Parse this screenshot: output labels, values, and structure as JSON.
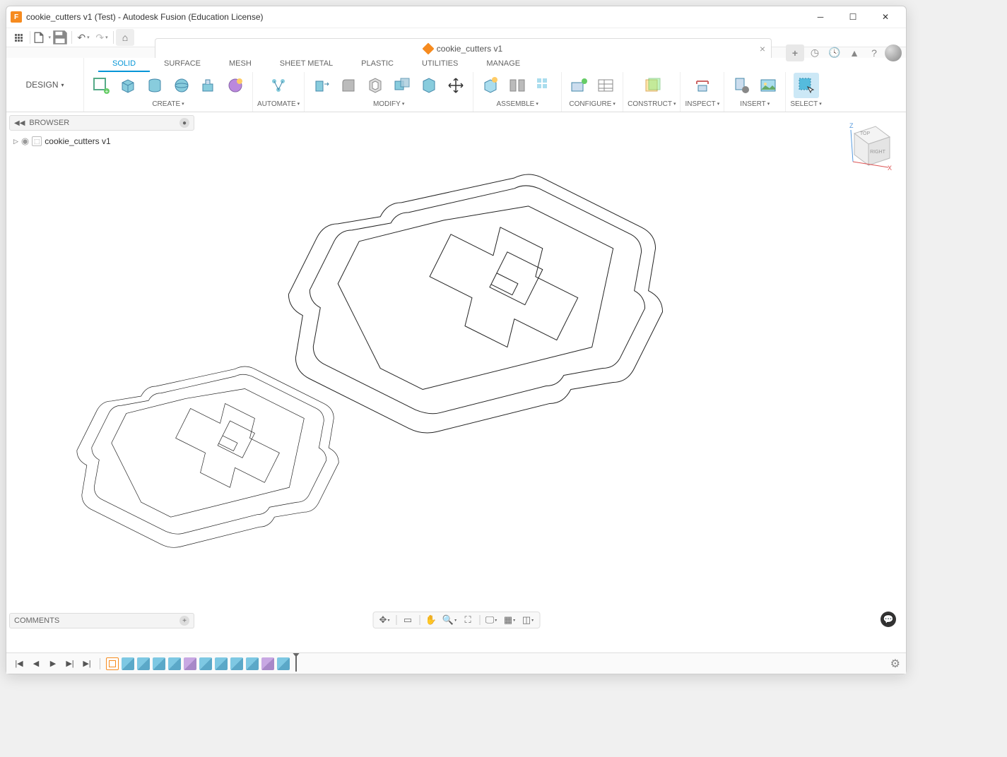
{
  "window": {
    "title": "cookie_cutters v1 (Test) - Autodesk Fusion (Education License)"
  },
  "doc_tab": {
    "name": "cookie_cutters v1"
  },
  "workspace": {
    "label": "DESIGN"
  },
  "ribbon_tabs": [
    "SOLID",
    "SURFACE",
    "MESH",
    "SHEET METAL",
    "PLASTIC",
    "UTILITIES",
    "MANAGE"
  ],
  "ribbon_groups": {
    "create": "CREATE",
    "automate": "AUTOMATE",
    "modify": "MODIFY",
    "assemble": "ASSEMBLE",
    "configure": "CONFIGURE",
    "construct": "CONSTRUCT",
    "inspect": "INSPECT",
    "insert": "INSERT",
    "select": "SELECT"
  },
  "browser": {
    "title": "BROWSER",
    "root": "cookie_cutters v1"
  },
  "comments": {
    "title": "COMMENTS"
  },
  "viewcube": {
    "top": "TOP",
    "right": "RIGHT",
    "z": "Z",
    "x": "X"
  }
}
